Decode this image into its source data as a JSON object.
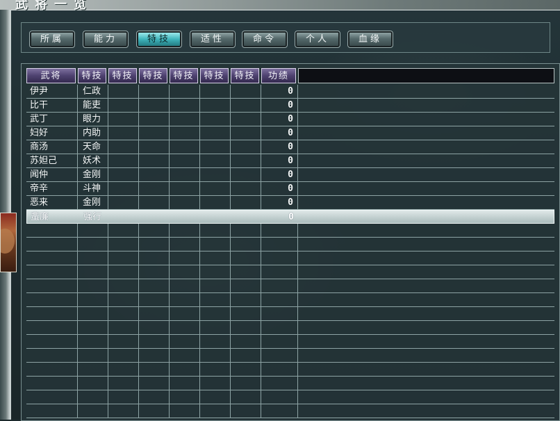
{
  "window": {
    "title": "武将一览"
  },
  "tabs": [
    {
      "label": "所属",
      "active": false
    },
    {
      "label": "能力",
      "active": false
    },
    {
      "label": "特技",
      "active": true
    },
    {
      "label": "适性",
      "active": false
    },
    {
      "label": "命令",
      "active": false
    },
    {
      "label": "个人",
      "active": false
    },
    {
      "label": "血缘",
      "active": false
    }
  ],
  "table": {
    "headers": [
      "武将",
      "特技",
      "特技",
      "特技",
      "特技",
      "特技",
      "特技",
      "功绩"
    ],
    "rows": [
      {
        "name": "伊尹",
        "skill": "仁政",
        "merit": "0"
      },
      {
        "name": "比干",
        "skill": "能吏",
        "merit": "0"
      },
      {
        "name": "武丁",
        "skill": "眼力",
        "merit": "0"
      },
      {
        "name": "妇好",
        "skill": "内助",
        "merit": "0"
      },
      {
        "name": "商汤",
        "skill": "天命",
        "merit": "0"
      },
      {
        "name": "苏妲己",
        "skill": "妖术",
        "merit": "0"
      },
      {
        "name": "闻仲",
        "skill": "金刚",
        "merit": "0"
      },
      {
        "name": "帝辛",
        "skill": "斗神",
        "merit": "0"
      },
      {
        "name": "恶来",
        "skill": "金刚",
        "merit": "0"
      },
      {
        "name": "蜚廉",
        "skill": "强行",
        "merit": "0",
        "selected": true
      }
    ]
  },
  "colors": {
    "tab_active": "#3fb4bb",
    "header_bg": "#4e4270",
    "row_selected": "#c6d4d4"
  }
}
